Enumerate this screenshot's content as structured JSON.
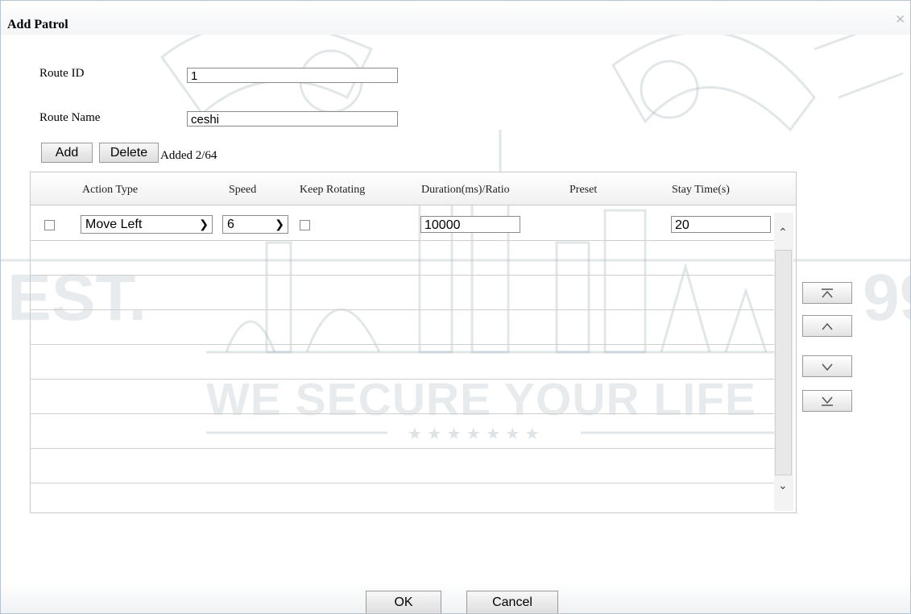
{
  "dialog": {
    "title": "Add Patrol"
  },
  "form": {
    "route_id_label": "Route ID",
    "route_id_value": "1",
    "route_name_label": "Route Name",
    "route_name_value": "ceshi"
  },
  "toolbar": {
    "add_label": "Add",
    "delete_label": "Delete",
    "added_status": "Added 2/64"
  },
  "table": {
    "columns": [
      "Action Type",
      "Speed",
      "Keep Rotating",
      "Duration(ms)/Ratio",
      "Preset",
      "Stay Time(s)"
    ],
    "rows": [
      {
        "selected": false,
        "action_type": "Move Left",
        "speed": "6",
        "keep_rotating": false,
        "duration": "10000",
        "preset": "",
        "stay_time": "20"
      }
    ]
  },
  "move_buttons": [
    {
      "name": "move-top-button",
      "icon": "arrow-to-top-icon"
    },
    {
      "name": "move-up-button",
      "icon": "chevron-up-icon"
    },
    {
      "name": "move-down-button",
      "icon": "chevron-down-icon"
    },
    {
      "name": "move-bottom-button",
      "icon": "arrow-to-bottom-icon"
    }
  ],
  "footer": {
    "ok_label": "OK",
    "cancel_label": "Cancel"
  },
  "watermark": {
    "slogan": "WE SECURE YOUR LIFE",
    "est": "EST.",
    "year_fragment": "99"
  }
}
